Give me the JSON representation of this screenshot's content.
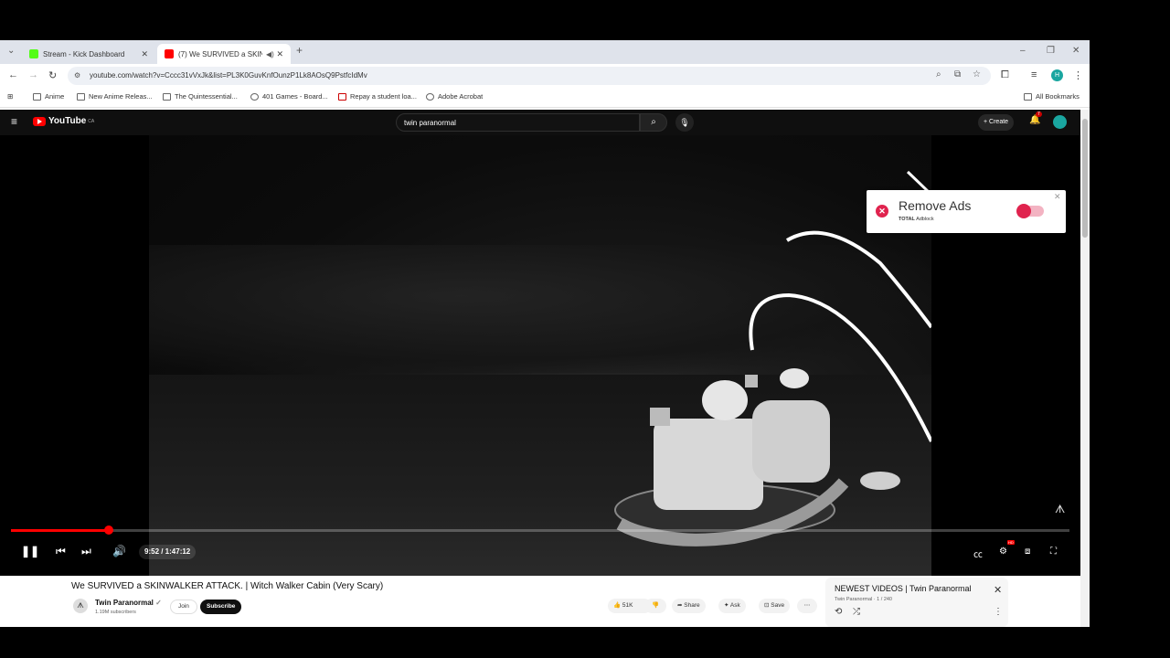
{
  "browser": {
    "tabs": [
      {
        "title": "Stream - Kick Dashboard",
        "favicon_color": "#53fc18"
      },
      {
        "title": "(7) We SURVIVED a SKINW",
        "favicon_color": "#ff0000"
      }
    ],
    "url": "youtube.com/watch?v=Cccc31vVxJk&list=PL3K0GuvKnfOunzP1Lk8AOsQ9PstfcIdMv",
    "profile_initial": "H",
    "bookmarks": [
      "Anime",
      "New Anime Releas...",
      "The Quintessential...",
      "401 Games - Board...",
      "Repay a student loa...",
      "Adobe Acrobat"
    ],
    "all_bookmarks": "All Bookmarks"
  },
  "youtube": {
    "logo_text": "YouTube",
    "region": "CA",
    "search_query": "twin paranormal",
    "create_label": "Create",
    "notification_count": "7"
  },
  "player": {
    "current_time": "9:52",
    "duration": "1:47:12",
    "time_display": "9:52 / 1:47:12",
    "progress_fraction": 0.092,
    "accent": "#ff0000"
  },
  "adblock": {
    "title": "Remove Ads",
    "brand": "TOTAL",
    "product": "Adblock",
    "accent": "#e0234e"
  },
  "video": {
    "title": "We SURVIVED a SKINWALKER ATTACK. | Witch Walker Cabin (Very Scary)",
    "channel": "Twin Paranormal",
    "subscribers": "1.19M subscribers",
    "join_label": "Join",
    "subscribe_label": "Subscribe",
    "likes": "51K",
    "share_label": "Share",
    "ask_label": "Ask",
    "save_label": "Save"
  },
  "playlist": {
    "title": "NEWEST VIDEOS | Twin Paranormal",
    "channel": "Twin Paranormal",
    "position": "1 / 240"
  }
}
